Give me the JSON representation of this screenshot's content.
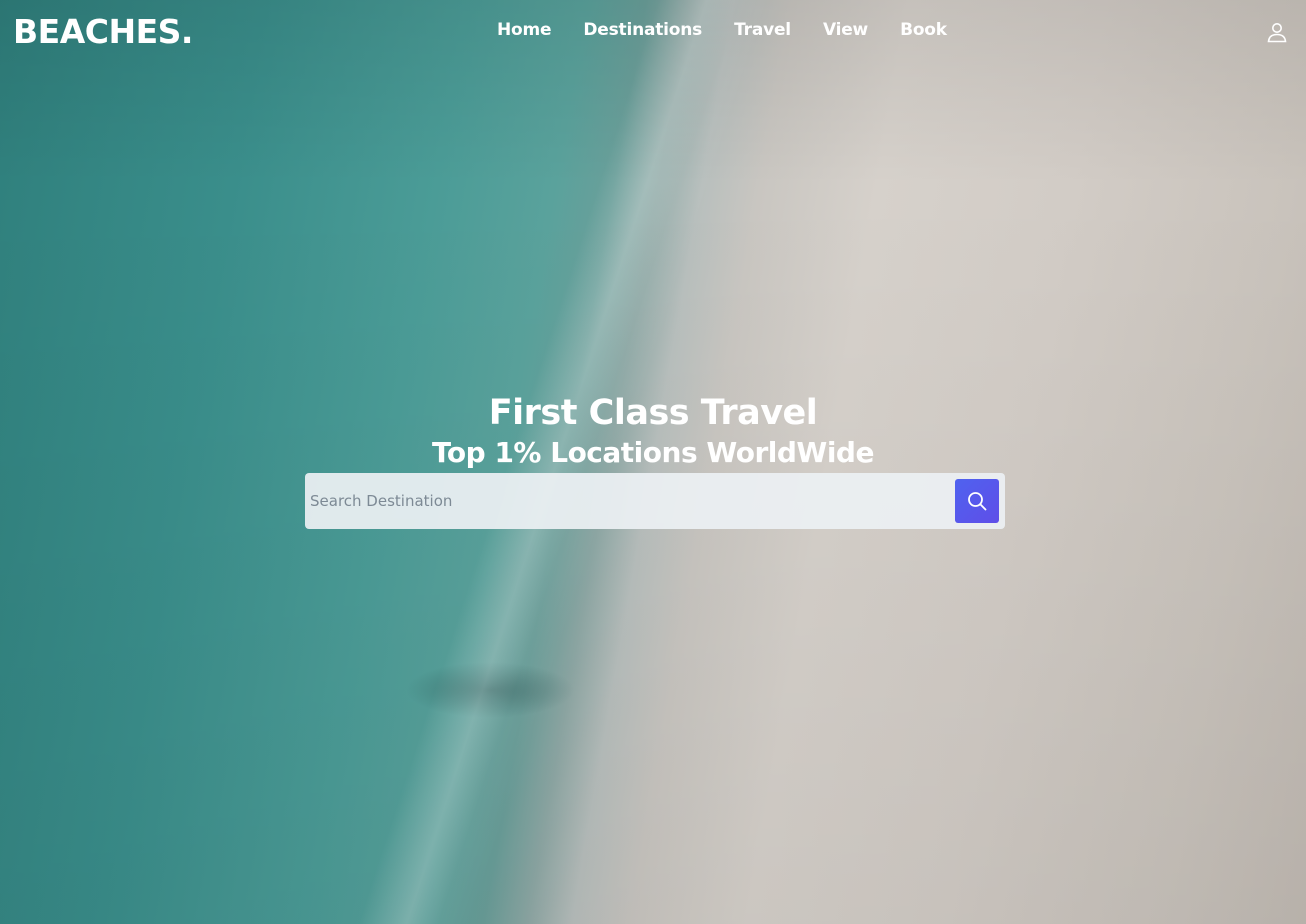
{
  "brand": {
    "logo": "BEACHES."
  },
  "nav": {
    "items": [
      {
        "label": "Home"
      },
      {
        "label": "Destinations"
      },
      {
        "label": "Travel"
      },
      {
        "label": "View"
      },
      {
        "label": "Book"
      }
    ],
    "account_icon": "user-icon"
  },
  "hero": {
    "title": "First Class Travel",
    "subtitle": "Top 1% Locations WorldWide"
  },
  "search": {
    "placeholder": "Search Destination",
    "value": "",
    "button_icon": "search-icon"
  },
  "colors": {
    "accent": "#5058ec",
    "text": "#ffffff",
    "search_bg": "#eceff3"
  }
}
